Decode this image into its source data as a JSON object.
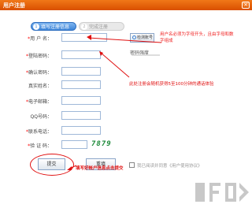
{
  "window": {
    "title": "用户注册",
    "close_symbol": "×"
  },
  "steps": [
    {
      "num": "1",
      "label": "填写注册信息"
    },
    {
      "num": "2",
      "label": "完成注册"
    }
  ],
  "form": {
    "username_label": "用 户 名：",
    "realname_label": "登陆密码：",
    "confirm_label": "确认密码：",
    "name_label": "真实姓名：",
    "email_label": "电子邮箱：",
    "qq_label": "QQ号码：",
    "phone_label": "联系电话：",
    "captcha_label": "验 证 码：",
    "required_star": "*"
  },
  "check_button": {
    "label": "检测账号"
  },
  "password_strength_label": "密码强度",
  "captcha_value": "7879",
  "buttons": {
    "submit": "提交",
    "reset": "重填"
  },
  "agree_text": "我已阅读并同意《用户使用协议》",
  "annotations": {
    "top": "用户名必须为字母开头，且由字母和数字组成",
    "middle": "此处注册会随机获得5至100分钟的通话体验",
    "bottom": "填写好帐户信息点击提交"
  },
  "colors": {
    "title_bar": "#e0600a",
    "annotation": "#e01010",
    "captcha": "#1e8a3a"
  }
}
